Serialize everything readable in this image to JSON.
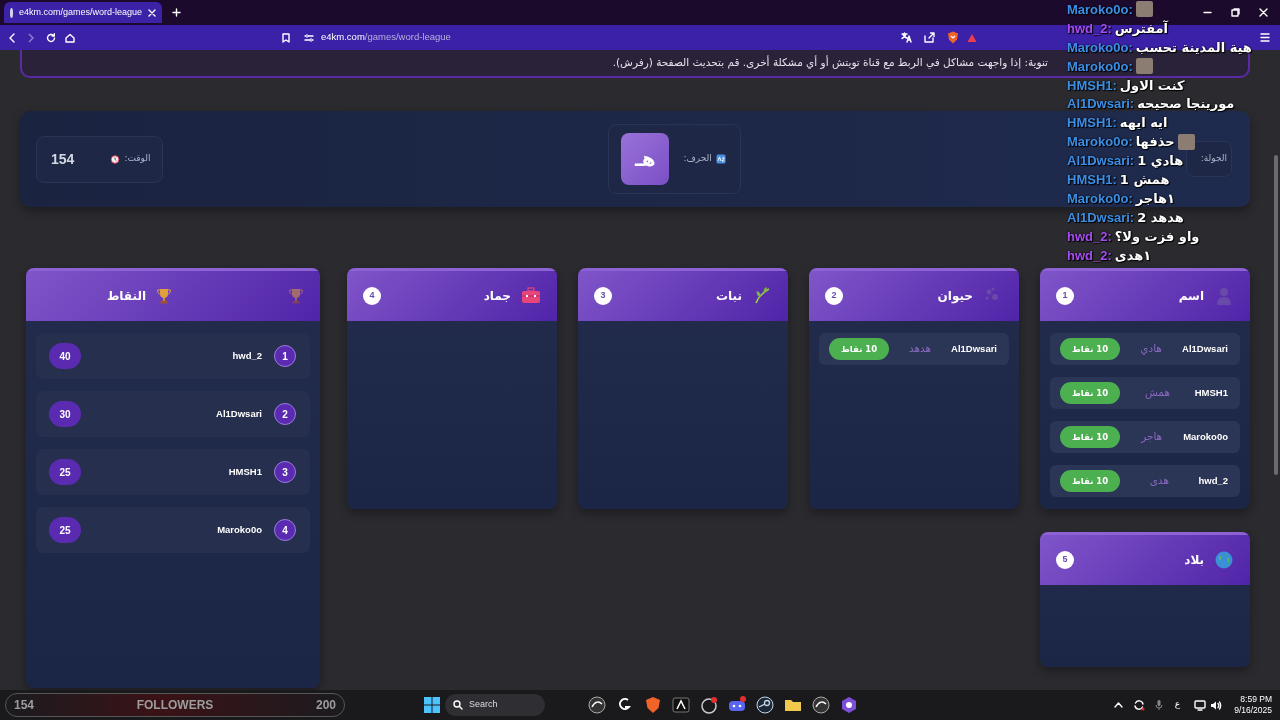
{
  "browser": {
    "tab_title": "e4km.com/games/word-league",
    "url_domain": "e4km.com",
    "url_path": "/games/word-league"
  },
  "notice": "تنوية: إذا واجهت مشاكل في الربط مع قناة تويتش أو أي مشكلة أخرى. قم بتحديث الصفحة (رفرش).",
  "status": {
    "round_label": "الجولة:",
    "letter_label": "الحرف:",
    "letter": "هـ",
    "time_label": "الوقت:",
    "time_value": "154"
  },
  "categories": [
    {
      "title": "اسم",
      "number": "1",
      "answers": [
        {
          "player": "Al1Dwsari",
          "word": "هادي",
          "points": "10 نقاط"
        },
        {
          "player": "HMSH1",
          "word": "همش",
          "points": "10 نقاط"
        },
        {
          "player": "Maroko0o",
          "word": "هاجر",
          "points": "10 نقاط"
        },
        {
          "player": "hwd_2",
          "word": "هدى",
          "points": "10 نقاط"
        }
      ]
    },
    {
      "title": "حيوان",
      "number": "2",
      "answers": [
        {
          "player": "Al1Dwsari",
          "word": "هدهد",
          "points": "10 نقاط"
        }
      ]
    },
    {
      "title": "نبات",
      "number": "3"
    },
    {
      "title": "جماد",
      "number": "4"
    },
    {
      "title": "بلاد",
      "number": "5"
    }
  ],
  "scoreboard": {
    "title": "النقاط",
    "rows": [
      {
        "rank": "1",
        "player": "hwd_2",
        "score": "40"
      },
      {
        "rank": "2",
        "player": "Al1Dwsari",
        "score": "30"
      },
      {
        "rank": "3",
        "player": "HMSH1",
        "score": "25"
      },
      {
        "rank": "4",
        "player": "Maroko0o",
        "score": "25"
      }
    ]
  },
  "chat": [
    {
      "user": "Maroko0o:",
      "color": "#3d8fe6",
      "emote": true
    },
    {
      "user": "hwd_2:",
      "color": "#a64ef2",
      "text": "آمفترس",
      "emote": false
    },
    {
      "user": "Maroko0o:",
      "color": "#3d8fe6",
      "text": "هية المدينة تحسب",
      "emote": false
    },
    {
      "user": "Maroko0o:",
      "color": "#3d8fe6",
      "emote": true
    },
    {
      "user": "HMSH1:",
      "color": "#3d8fe6",
      "text": "كنت الاول",
      "emote": false
    },
    {
      "user": "Al1Dwsari:",
      "color": "#3d8fe6",
      "text": "مورينجا صحيحه",
      "emote": false
    },
    {
      "user": "HMSH1:",
      "color": "#3d8fe6",
      "text": "ايه ايهه",
      "emote": false
    },
    {
      "user": "Maroko0o:",
      "color": "#3d8fe6",
      "text": "حذفها",
      "emote": true
    },
    {
      "user": "Al1Dwsari:",
      "color": "#3d8fe6",
      "text": "هادي 1",
      "emote": false
    },
    {
      "user": "HMSH1:",
      "color": "#3d8fe6",
      "text": "همش 1",
      "emote": false
    },
    {
      "user": "Maroko0o:",
      "color": "#3d8fe6",
      "text": "١هاجر",
      "emote": false
    },
    {
      "user": "Al1Dwsari:",
      "color": "#3d8fe6",
      "text": "هدهد 2",
      "emote": false
    },
    {
      "user": "hwd_2:",
      "color": "#a64ef2",
      "text": "واو فزت ولا؟",
      "emote": false
    },
    {
      "user": "hwd_2:",
      "color": "#a64ef2",
      "text": "١هدى",
      "emote": false
    }
  ],
  "taskbar": {
    "followers_current": "154",
    "followers_label": "FOLLOWERS",
    "followers_goal": "200",
    "search": "Search",
    "language": "ع",
    "time": "8:59 PM",
    "date": "9/16/2025"
  }
}
